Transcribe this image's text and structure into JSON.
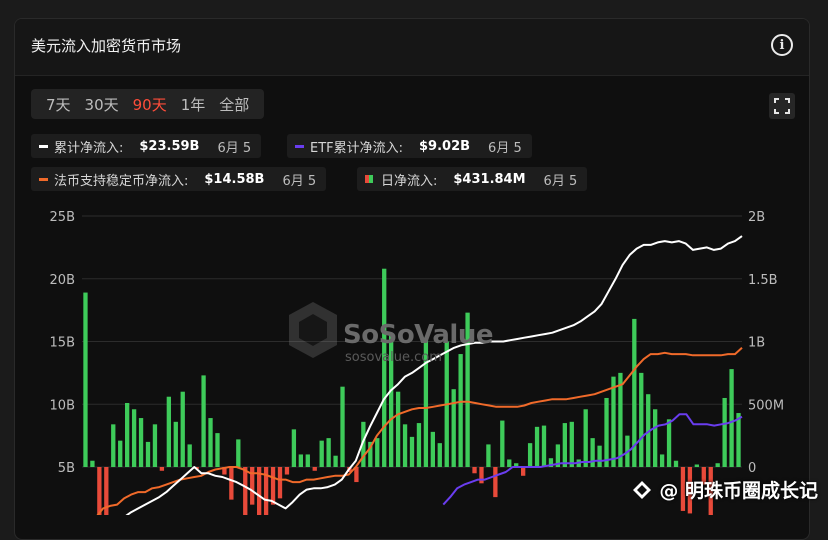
{
  "card": {
    "title": "美元流入加密货币市场"
  },
  "tabs": [
    {
      "label": "7天",
      "active": false
    },
    {
      "label": "30天",
      "active": false
    },
    {
      "label": "90天",
      "active": true
    },
    {
      "label": "1年",
      "active": false
    },
    {
      "label": "全部",
      "active": false
    }
  ],
  "legend": [
    {
      "label": "累计净流入:",
      "value": "$23.59B",
      "date": "6月 5",
      "color": "#ffffff",
      "shape": "line"
    },
    {
      "label": "ETF累计净流入:",
      "value": "$9.02B",
      "date": "6月 5",
      "color": "#6a3df0",
      "shape": "line"
    },
    {
      "label": "法币支持稳定币净流入:",
      "value": "$14.58B",
      "date": "6月 5",
      "color": "#f06a2a",
      "shape": "line"
    },
    {
      "label": "日净流入:",
      "value": "$431.84M",
      "date": "6月 5",
      "color": "#3ecb5a",
      "negative_color": "#e84a3a",
      "shape": "bar"
    }
  ],
  "watermark": {
    "brand": "SoSoValue",
    "url": "sosovalue.com"
  },
  "author": {
    "handle": "@ 明珠币圈成长记"
  },
  "icons": {
    "info": "info-icon",
    "expand": "expand-icon",
    "logo": "weibo-logo-icon"
  },
  "chart_data": {
    "type": "bar",
    "left_axis": {
      "ticks": [
        "5B",
        "10B",
        "15B",
        "20B",
        "25B"
      ],
      "range": [
        0,
        25
      ]
    },
    "right_axis": {
      "ticks": [
        "0",
        "500M",
        "1B",
        "1.5B",
        "2B"
      ],
      "range": [
        -0.4,
        2
      ]
    },
    "daily_net_inflow_B": [
      1.39,
      0.05,
      -0.52,
      -0.62,
      0.34,
      0.21,
      0.51,
      0.46,
      0.39,
      0.2,
      0.34,
      -0.03,
      0.56,
      0.36,
      0.6,
      0.18,
      -0.01,
      0.73,
      0.39,
      0.27,
      -0.06,
      -0.26,
      0.22,
      -0.41,
      -0.3,
      -0.44,
      -0.5,
      -0.3,
      -0.25,
      -0.06,
      0.3,
      0.1,
      0.1,
      -0.03,
      0.21,
      0.23,
      0.09,
      0.64,
      -0.04,
      -0.12,
      0.36,
      0.2,
      0.23,
      1.58,
      1.05,
      0.6,
      0.34,
      0.24,
      0.35,
      1.03,
      0.28,
      0.19,
      1.0,
      0.62,
      0.9,
      1.23,
      -0.05,
      -0.13,
      0.18,
      -0.24,
      0.37,
      0.06,
      0.03,
      -0.07,
      0.19,
      0.32,
      0.33,
      0.07,
      0.18,
      0.35,
      0.36,
      0.06,
      0.46,
      0.23,
      0.17,
      0.55,
      0.72,
      0.75,
      0.25,
      1.18,
      0.75,
      0.58,
      0.46,
      0.1,
      0.38,
      0.05,
      -0.35,
      -0.37,
      0.02,
      -0.14,
      -0.52,
      0.03,
      0.55,
      0.78,
      0.43
    ],
    "series": [
      {
        "name": "累计净流入",
        "axis": "right",
        "color": "#ffffff",
        "values": [
          -0.7,
          -0.6,
          -0.6,
          -0.55,
          -0.5,
          -0.45,
          -0.4,
          -0.36,
          -0.33,
          -0.3,
          -0.27,
          -0.24,
          -0.2,
          -0.15,
          -0.1,
          -0.05,
          0.0,
          -0.05,
          -0.05,
          -0.07,
          -0.08,
          -0.1,
          -0.12,
          -0.15,
          -0.18,
          -0.22,
          -0.26,
          -0.27,
          -0.3,
          -0.33,
          -0.28,
          -0.22,
          -0.18,
          -0.17,
          -0.17,
          -0.16,
          -0.14,
          -0.1,
          -0.02,
          0.05,
          0.2,
          0.32,
          0.43,
          0.54,
          0.61,
          0.66,
          0.72,
          0.75,
          0.79,
          0.83,
          0.86,
          0.89,
          0.92,
          0.95,
          0.97,
          0.98,
          0.99,
          0.99,
          1.0,
          1.0,
          1.0,
          1.01,
          1.02,
          1.03,
          1.04,
          1.05,
          1.06,
          1.07,
          1.09,
          1.11,
          1.13,
          1.16,
          1.2,
          1.24,
          1.3,
          1.4,
          1.5,
          1.61,
          1.69,
          1.74,
          1.77,
          1.77,
          1.79,
          1.8,
          1.79,
          1.8,
          1.78,
          1.73,
          1.74,
          1.75,
          1.73,
          1.74,
          1.78,
          1.8,
          1.84
        ]
      },
      {
        "name": "法币支持稳定币净流入",
        "axis": "right",
        "color": "#f06a2a",
        "values": [
          -0.47,
          -0.44,
          -0.4,
          -0.33,
          -0.31,
          -0.3,
          -0.25,
          -0.22,
          -0.2,
          -0.2,
          -0.17,
          -0.16,
          -0.14,
          -0.12,
          -0.1,
          -0.09,
          -0.08,
          -0.07,
          -0.04,
          -0.02,
          -0.01,
          0.0,
          0.0,
          -0.02,
          -0.05,
          -0.05,
          -0.06,
          -0.08,
          -0.1,
          -0.1,
          -0.12,
          -0.12,
          -0.1,
          -0.1,
          -0.09,
          -0.08,
          -0.07,
          -0.07,
          -0.06,
          0.0,
          0.08,
          0.15,
          0.25,
          0.32,
          0.38,
          0.42,
          0.44,
          0.46,
          0.47,
          0.47,
          0.48,
          0.49,
          0.5,
          0.51,
          0.52,
          0.52,
          0.51,
          0.5,
          0.49,
          0.48,
          0.48,
          0.48,
          0.48,
          0.49,
          0.51,
          0.52,
          0.53,
          0.54,
          0.54,
          0.54,
          0.55,
          0.56,
          0.57,
          0.58,
          0.6,
          0.62,
          0.64,
          0.66,
          0.73,
          0.8,
          0.86,
          0.9,
          0.9,
          0.91,
          0.9,
          0.9,
          0.9,
          0.89,
          0.89,
          0.89,
          0.89,
          0.89,
          0.9,
          0.9,
          0.95
        ]
      },
      {
        "name": "ETF累计净流入",
        "axis": "right",
        "color": "#6a3df0",
        "values": [
          null,
          null,
          null,
          null,
          null,
          null,
          null,
          null,
          null,
          null,
          null,
          null,
          null,
          null,
          null,
          null,
          null,
          null,
          null,
          null,
          null,
          null,
          null,
          null,
          null,
          null,
          null,
          null,
          null,
          null,
          null,
          null,
          null,
          null,
          null,
          null,
          null,
          null,
          null,
          null,
          null,
          null,
          null,
          null,
          null,
          null,
          null,
          null,
          null,
          null,
          null,
          null,
          -0.3,
          -0.24,
          -0.17,
          -0.14,
          -0.12,
          -0.1,
          -0.1,
          -0.08,
          -0.06,
          -0.04,
          0.0,
          0.0,
          0.0,
          0.0,
          0.0,
          0.01,
          0.02,
          0.03,
          0.03,
          0.03,
          0.04,
          0.04,
          0.05,
          0.05,
          0.06,
          0.07,
          0.1,
          0.14,
          0.2,
          0.26,
          0.3,
          0.33,
          0.34,
          0.37,
          0.42,
          0.42,
          0.34,
          0.34,
          0.34,
          0.33,
          0.34,
          0.35,
          0.37,
          0.4
        ]
      }
    ],
    "legend_position": "top-left",
    "grid": true
  }
}
